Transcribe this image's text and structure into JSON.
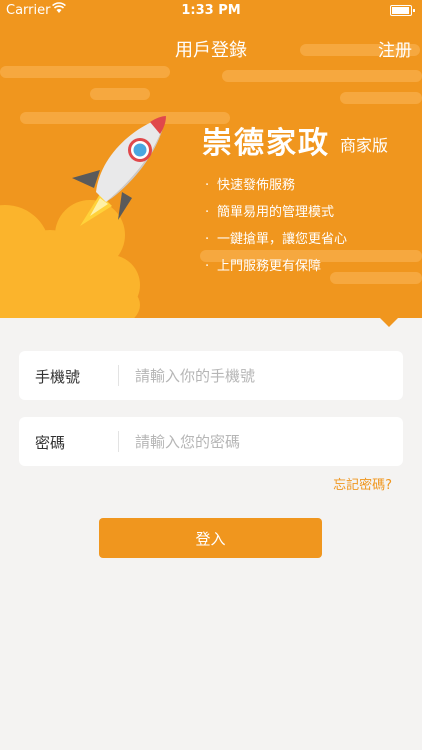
{
  "status_bar": {
    "carrier": "Carrier",
    "time": "1:33 PM"
  },
  "nav": {
    "title": "用戶登錄",
    "register_label": "注册"
  },
  "brand": {
    "name": "崇德家政",
    "edition": "商家版",
    "features": [
      "快速發佈服務",
      "簡單易用的管理模式",
      "一鍵搶單，讓您更省心",
      "上門服務更有保障"
    ]
  },
  "form": {
    "phone": {
      "label": "手機號",
      "placeholder": "請輸入你的手機號"
    },
    "password": {
      "label": "密碼",
      "placeholder": "請輸入您的密碼"
    },
    "forgot_label": "忘記密碼?",
    "login_label": "登入"
  },
  "colors": {
    "accent": "#f0961e",
    "background": "#f4f3f2",
    "cloud": "#fbb42c"
  }
}
